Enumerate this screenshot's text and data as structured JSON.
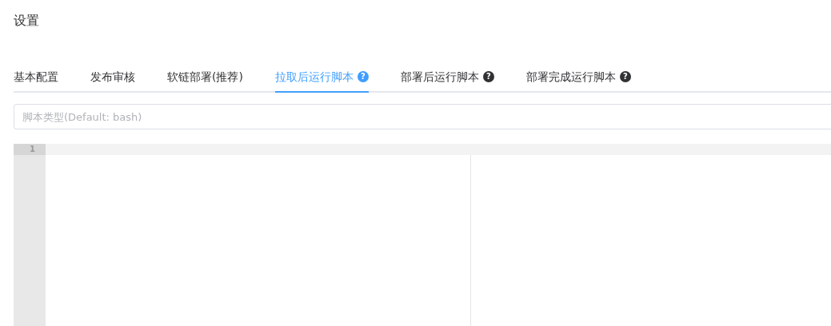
{
  "title": "设置",
  "tabs": [
    {
      "label": "基本配置",
      "selected": false
    },
    {
      "label": "发布审核",
      "selected": false
    },
    {
      "label": "软链部署(推荐)",
      "selected": false
    },
    {
      "label": "拉取后运行脚本",
      "selected": true,
      "help_icon": "?"
    },
    {
      "label": "部署后运行脚本",
      "selected": false,
      "help_icon": "?"
    },
    {
      "label": "部署完成运行脚本",
      "selected": false,
      "help_icon": "?"
    }
  ],
  "script_type": {
    "placeholder": "脚本类型(Default: bash)"
  },
  "editor": {
    "line_numbers": [
      "1"
    ]
  }
}
